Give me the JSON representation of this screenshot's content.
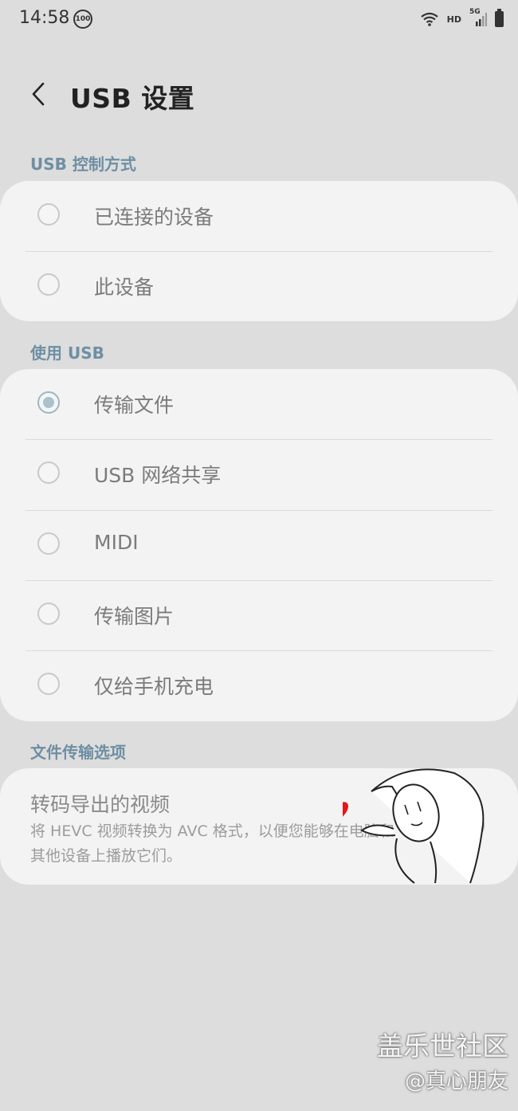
{
  "status": {
    "time": "14:58",
    "badge": "100",
    "net": "HD",
    "gen": "5G"
  },
  "header": {
    "title": "USB 设置"
  },
  "sections": {
    "control": {
      "label": "USB 控制方式",
      "items": [
        {
          "label": "已连接的设备",
          "checked": false
        },
        {
          "label": "此设备",
          "checked": false
        }
      ]
    },
    "use": {
      "label": "使用 USB",
      "items": [
        {
          "label": "传输文件",
          "checked": true
        },
        {
          "label": "USB 网络共享",
          "checked": false
        },
        {
          "label": "MIDI",
          "checked": false
        },
        {
          "label": "传输图片",
          "checked": false
        },
        {
          "label": "仅给手机充电",
          "checked": false
        }
      ]
    },
    "transfer": {
      "label": "文件传输选项",
      "option": {
        "title": "转码导出的视频",
        "description": "将 HEVC 视频转换为 AVC 格式，以便您能够在电脑和其他设备上播放它们。",
        "enabled": false
      }
    }
  },
  "watermark": {
    "line1": "盖乐世社区",
    "line2": "@真心朋友"
  }
}
